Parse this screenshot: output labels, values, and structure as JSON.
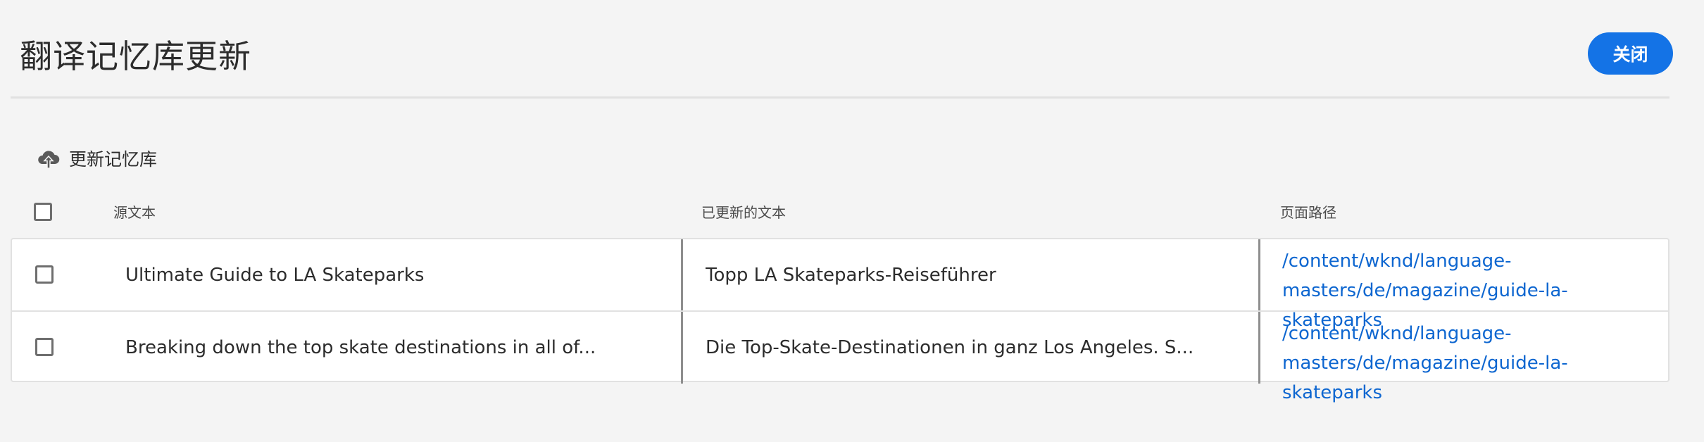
{
  "header": {
    "title": "翻译记忆库更新",
    "close_label": "关闭"
  },
  "toolbar": {
    "update_icon": "cloud-upload-icon",
    "update_label": "更新记忆库"
  },
  "table": {
    "columns": [
      "源文本",
      "已更新的文本",
      "页面路径"
    ],
    "rows": [
      {
        "source": "Ultimate Guide to LA Skateparks",
        "updated": "Topp LA Skateparks-Reiseführer",
        "path_line1": "/content/wknd/language-",
        "path_line2": "masters/de/magazine/guide-la-skateparks"
      },
      {
        "source": "Breaking down the top skate destinations in all of...",
        "updated": "Die Top-Skate-Destinationen in ganz Los Angeles. S...",
        "path_line1": "/content/wknd/language-",
        "path_line2": "masters/de/magazine/guide-la-skateparks"
      }
    ]
  },
  "colors": {
    "accent": "#1473e6",
    "link": "#0d66d0",
    "background": "#f4f4f4"
  }
}
